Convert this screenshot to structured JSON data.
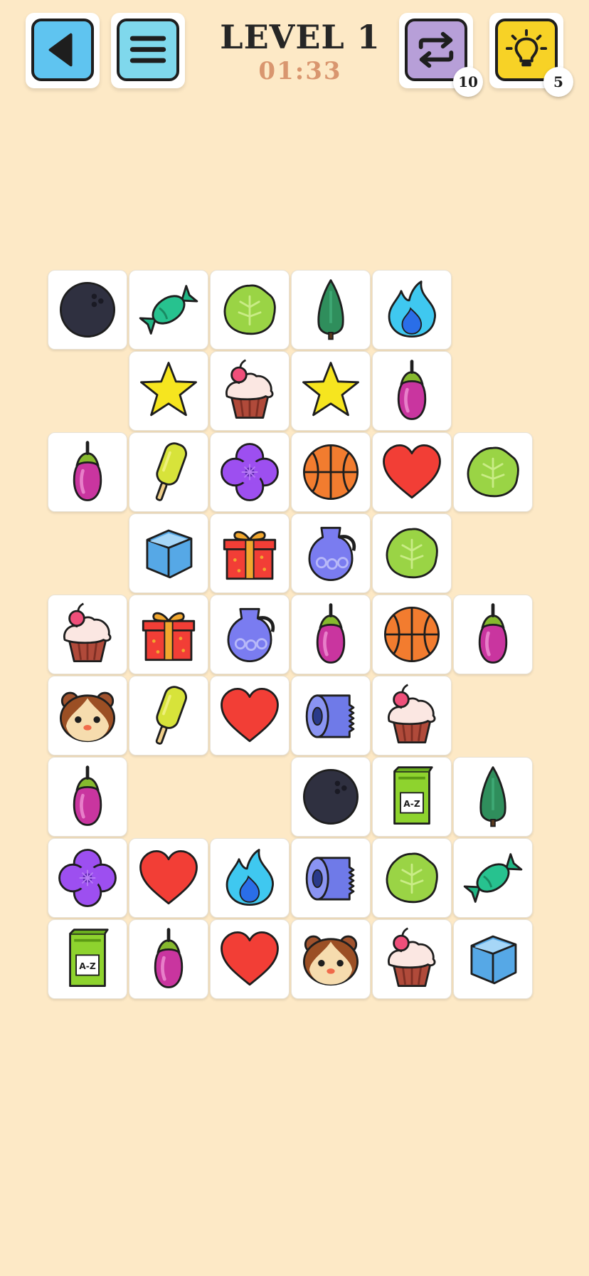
{
  "header": {
    "level_title": "LEVEL 1",
    "timer": "01:33",
    "shuffle_count": "10",
    "hint_count": "5"
  },
  "colors": {
    "background": "#fde9c6",
    "back_button": "#5fc4f0",
    "menu_button": "#7fd8ec",
    "shuffle_button": "#b79fd8",
    "hint_button": "#f7d226",
    "timer_text": "#d9966f"
  },
  "board": {
    "rows": [
      [
        "bowling-ball",
        "candy",
        "cabbage",
        "tree",
        "flame",
        null
      ],
      [
        null,
        "star",
        "cupcake",
        "star",
        "eggplant",
        null
      ],
      [
        "eggplant",
        "popsicle",
        "flower",
        "basketball",
        "heart",
        "cabbage"
      ],
      [
        null,
        "ice-cube",
        "gift",
        "jug",
        "cabbage",
        null
      ],
      [
        "cupcake",
        "gift",
        "jug",
        "eggplant",
        "basketball",
        "eggplant"
      ],
      [
        "hamster",
        "popsicle",
        "heart",
        "toilet-paper",
        "cupcake",
        null
      ],
      [
        "eggplant",
        null,
        null,
        "bowling-ball",
        "book",
        "tree"
      ],
      [
        "flower",
        "heart",
        "flame",
        "toilet-paper",
        "cabbage",
        "candy"
      ],
      [
        "book",
        "eggplant",
        "heart",
        "hamster",
        "cupcake",
        "ice-cube"
      ]
    ],
    "book_label": "A-Z"
  }
}
